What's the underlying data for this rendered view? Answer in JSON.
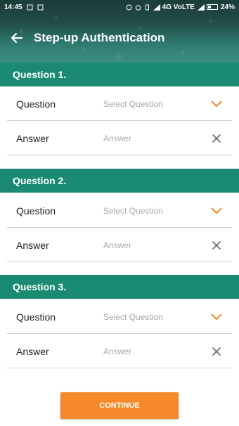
{
  "status_bar": {
    "time": "14:45",
    "network": "4G VoLTE",
    "battery": "24%"
  },
  "toolbar": {
    "title": "Step-up Authentication",
    "back_icon": "arrow-left-icon"
  },
  "sections": [
    {
      "header": "Question 1.",
      "question_label": "Question",
      "question_placeholder": "Select Question",
      "answer_label": "Answer",
      "answer_placeholder": "Answer"
    },
    {
      "header": "Question 2.",
      "question_label": "Question",
      "question_placeholder": "Select Question",
      "answer_label": "Answer",
      "answer_placeholder": "Answer"
    },
    {
      "header": "Question 3.",
      "question_label": "Question",
      "question_placeholder": "Select Question",
      "answer_label": "Answer",
      "answer_placeholder": "Answer"
    }
  ],
  "continue_label": "CONTINUE",
  "colors": {
    "section_header": "#1a8a72",
    "accent_orange": "#f68a2a",
    "clear_icon": "#6b6b6b"
  }
}
